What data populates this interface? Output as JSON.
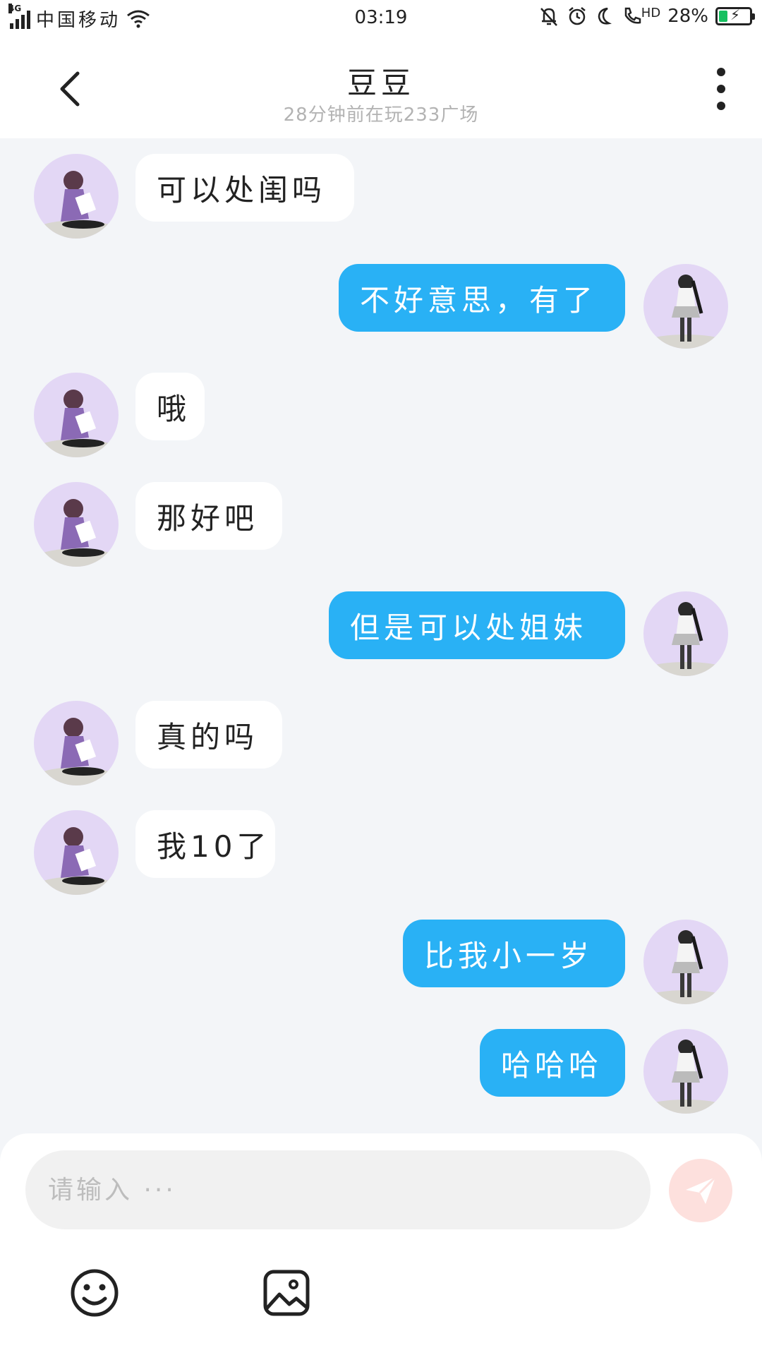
{
  "status_bar": {
    "network": "4G",
    "carrier": "中国移动",
    "time": "03:19",
    "hd_label": "HD",
    "battery": "28%"
  },
  "header": {
    "title": "豆豆",
    "subtitle": "28分钟前在玩233广场"
  },
  "messages": [
    {
      "side": "in",
      "text": "可以处闺吗"
    },
    {
      "side": "out",
      "text": "不好意思，有了"
    },
    {
      "side": "in",
      "text": "哦"
    },
    {
      "side": "in",
      "text": "那好吧"
    },
    {
      "side": "out",
      "text": "但是可以处姐妹"
    },
    {
      "side": "in",
      "text": "真的吗"
    },
    {
      "side": "in",
      "text": "我10了"
    },
    {
      "side": "out",
      "text": "比我小一岁"
    },
    {
      "side": "out",
      "text": "哈哈哈"
    }
  ],
  "composer": {
    "placeholder": "请输入 ···",
    "value": ""
  },
  "colors": {
    "outgoing_bubble": "#29b1f5",
    "incoming_bubble": "#ffffff",
    "background": "#f3f5f8",
    "send_button": "#fde0dd",
    "avatar_bg": "#e3d7f5"
  },
  "icons": [
    "back-arrow-icon",
    "more-vertical-icon",
    "send-icon",
    "emoji-icon",
    "image-icon",
    "wifi-icon",
    "bell-off-icon",
    "alarm-icon",
    "moon-icon",
    "call-icon",
    "battery-icon"
  ]
}
